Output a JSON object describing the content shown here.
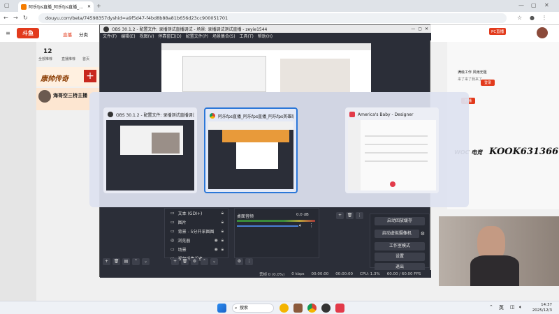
{
  "browser": {
    "tab_title": "阿乐fps直播_阿乐fps直播_阿乐",
    "url": "douyu.com/beta/74598357dyshid=a9f5d47-f4bd8b88a81b656d23cc900051701"
  },
  "site": {
    "logo": "斗鱼",
    "nav_live": "直播",
    "nav_category": "分类",
    "sidebar_count": "12",
    "sidebar_label1": "全部推荐",
    "sidebar_label2": "直播推荐",
    "sidebar_label3": "首页",
    "pc_live_badge": "PC直播",
    "banner_text": "康帅传奇",
    "streamer_name": "海哥空三桥主播",
    "right_label1": "原生2·开",
    "right_label2": "登录",
    "right_label3": "开播",
    "promo_title": "满级工作 风雨无阻",
    "promo_sub": "来了来了我来了",
    "kook_text": "KOOK631366",
    "woc_text": "WOC 电竞"
  },
  "obs": {
    "title": "OBS 30.1.2 - 配置文件: 录播测试直播调试 - 场景: 录播调试测试直播 - zeyie1544",
    "menu": [
      "文件(F)",
      "编辑(E)",
      "视图(V)",
      "停靠窗口(D)",
      "配置文件(P)",
      "场景集合(S)",
      "工具(T)",
      "帮助(H)"
    ],
    "sources": [
      {
        "name": "文本 (GDI+)"
      },
      {
        "name": "图片"
      },
      {
        "name": "背景 - 5分开采图图"
      },
      {
        "name": "浏览器"
      },
      {
        "name": "场景"
      },
      {
        "name": "视频采集设备"
      }
    ],
    "audio_mixer_label": "桌面音频",
    "audio_db": "0.0 dB",
    "controls": [
      "启动虚拟摄像机",
      "工作室模式",
      "设置",
      "退出"
    ],
    "controls_partial": "启动回放缓存",
    "status": {
      "dropped": "丢帧 0 (0.0%)",
      "kbps": "0 kbps",
      "rec_time1": "00:00:00",
      "rec_time2": "00:00:00",
      "cpu": "CPU: 1.3%",
      "fps": "60.00 / 60.00 FPS"
    }
  },
  "switcher": {
    "cards": [
      {
        "title": "OBS 30.1.2 - 配置文件: 录播测试直播调试 - 场景..."
      },
      {
        "title": "阿乐fps直播_阿乐fps直播_阿乐fps英雄联盟直播 - Google..."
      },
      {
        "title": "America's Baby - Designer"
      }
    ]
  },
  "taskbar": {
    "search": "搜索",
    "lang": "英",
    "time": "14:37",
    "date": "2025/12/3"
  },
  "colors": {
    "douyu_red": "#e23a1c",
    "obs_dark": "#2b2e38",
    "selected_border": "#2b77d8",
    "switcher_bg": "#dee2f0"
  }
}
